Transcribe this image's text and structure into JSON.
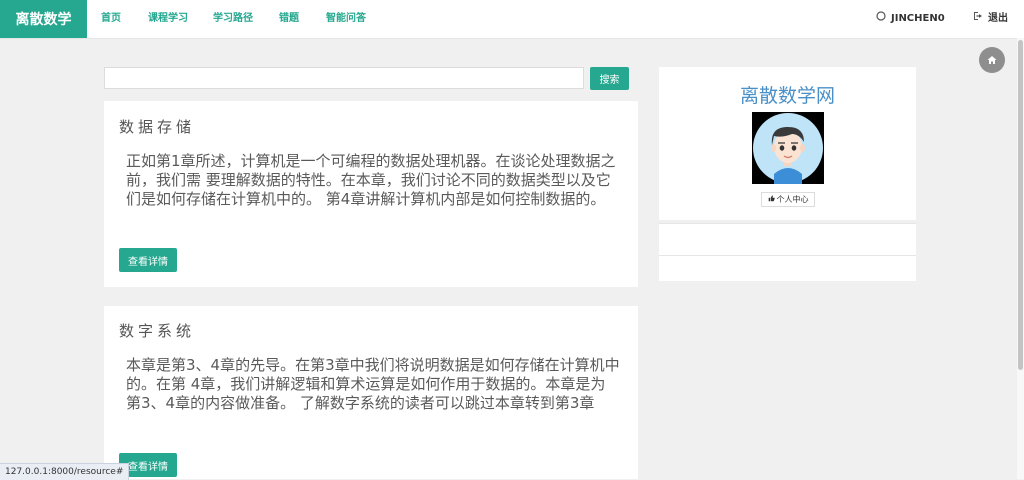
{
  "nav": {
    "brand": "离散数学",
    "items": [
      "首页",
      "课程学习",
      "学习路径",
      "错题",
      "智能问答"
    ],
    "user": "JINCHEN0",
    "logout": "退出",
    "user_icon": "user-icon",
    "logout_icon": "logout-icon"
  },
  "search": {
    "value": "",
    "button": "搜索"
  },
  "cards": [
    {
      "title": "数据存储",
      "body": "正如第1章所述，计算机是一个可编程的数据处理机器。在谈论处理数据之前，我们需 要理解数据的特性。在本章，我们讨论不同的数据类型以及它们是如何存储在计算机中的。 第4章讲解计算机内部是如何控制数据的。",
      "button": "查看详情"
    },
    {
      "title": "数字系统",
      "body": "本章是第3、4章的先导。在第3章中我们将说明数据是如何存储在计算机中的。在第 4章，我们讲解逻辑和算术运算是如何作用于数据的。本章是为第3、4章的内容做准备。 了解数字系统的读者可以跳过本章转到第3章",
      "button": "查看详情"
    }
  ],
  "profile": {
    "site_title": "离散数学网",
    "personal_center": "个人中心"
  },
  "status_url": "127.0.0.1:8000/resource#",
  "colors": {
    "accent": "#25a88f",
    "title_blue": "#4a90c8"
  }
}
